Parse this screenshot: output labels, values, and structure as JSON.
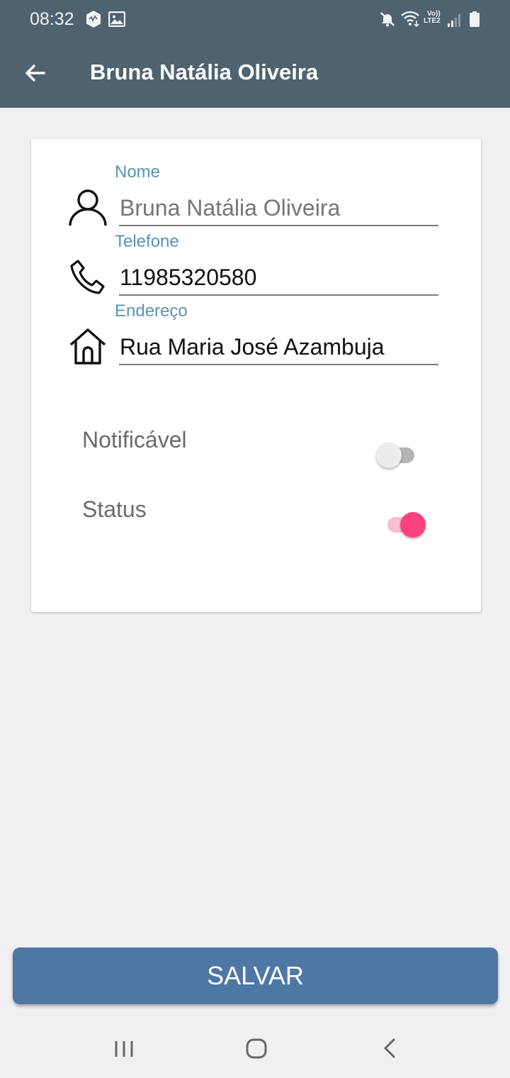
{
  "status_bar": {
    "time": "08:32",
    "left_icons": [
      "notification-badge-icon",
      "image-icon"
    ],
    "right_icons": [
      "mute-icon",
      "wifi-icon",
      "lte-signal-icon",
      "signal-bars-icon",
      "battery-icon"
    ],
    "lte_label_top": "Vo))",
    "lte_label_bottom": "LTE2"
  },
  "app_bar": {
    "title": "Bruna Natália Oliveira",
    "back_icon": "arrow-left-icon",
    "background": "#4e6270"
  },
  "form": {
    "fields": [
      {
        "label": "Nome",
        "value": "",
        "placeholder": "Bruna Natália Oliveira",
        "icon": "person-icon"
      },
      {
        "label": "Telefone",
        "value": "11985320580",
        "placeholder": "",
        "icon": "phone-icon"
      },
      {
        "label": "Endereço",
        "value": "Rua Maria José Azambuja",
        "placeholder": "",
        "icon": "home-icon"
      }
    ],
    "label_color": "#5a93b5"
  },
  "toggles": [
    {
      "label": "Notificável",
      "on": false
    },
    {
      "label": "Status",
      "on": true
    }
  ],
  "accent_color": "#ff4081",
  "save_button": {
    "label": "SALVAR",
    "color": "#4f77a4"
  },
  "nav_bar": {
    "icons": [
      "recent-apps-icon",
      "home-circle-icon",
      "back-chevron-icon"
    ]
  }
}
